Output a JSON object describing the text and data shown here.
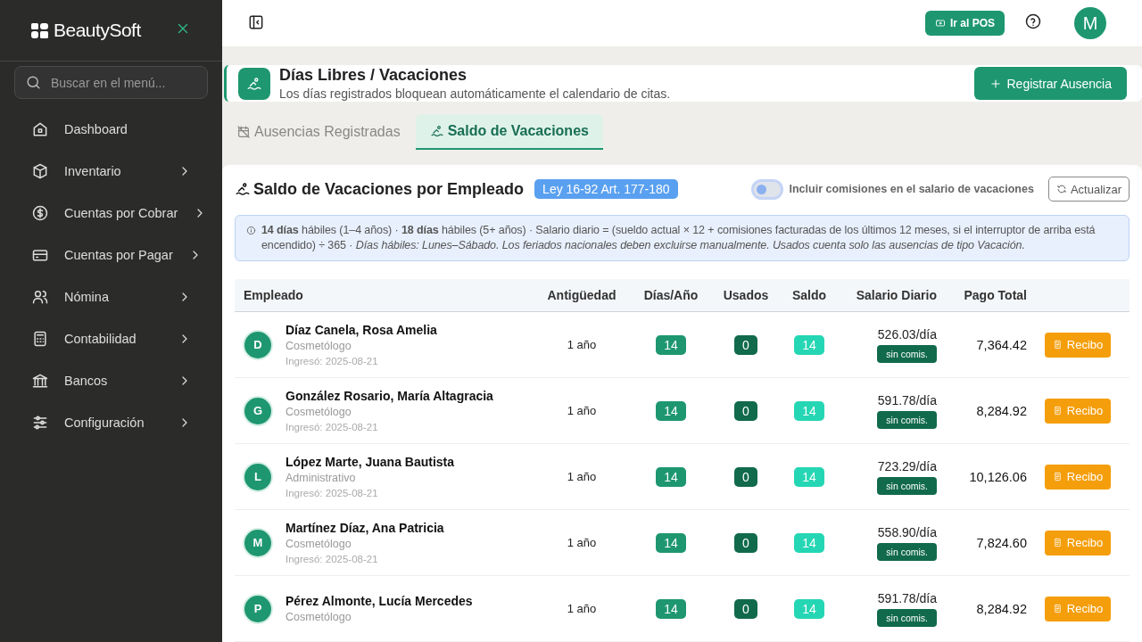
{
  "sidebar": {
    "brand": "BeautySoft",
    "search": {
      "placeholder": "Buscar en el menú..."
    },
    "items": [
      {
        "label": "Dashboard",
        "has_children": false
      },
      {
        "label": "Inventario",
        "has_children": true
      },
      {
        "label": "Cuentas por Cobrar",
        "has_children": true
      },
      {
        "label": "Cuentas por Pagar",
        "has_children": true
      },
      {
        "label": "Nómina",
        "has_children": true
      },
      {
        "label": "Contabilidad",
        "has_children": true
      },
      {
        "label": "Bancos",
        "has_children": true
      },
      {
        "label": "Configuración",
        "has_children": true
      }
    ]
  },
  "topbar": {
    "pos_button": "Ir al POS",
    "avatar": "M"
  },
  "header": {
    "title": "Días Libres / Vacaciones",
    "subtitle": "Los días registrados bloquean automáticamente el calendario de citas.",
    "action": "Registrar Ausencia"
  },
  "tabs": [
    {
      "label": "Ausencias Registradas",
      "selected": false
    },
    {
      "label": "Saldo de Vacaciones",
      "selected": true
    }
  ],
  "panel": {
    "title": "Saldo de Vacaciones por Empleado",
    "law_badge": "Ley 16-92 Art. 177-180",
    "toggle": {
      "label": "Incluir comisiones en el salario de vacaciones",
      "on": false
    },
    "refresh": "Actualizar",
    "info": "**14 días** hábiles (1–4 años) · **18 días** hábiles (5+ años) · Salario diario = (sueldo actual × 12 + comisiones facturadas de los últimos 12 meses, si el interruptor de arriba está encendido) ÷ 365 · *Días hábiles: Lunes–Sábado. Los feriados nacionales deben excluirse manualmente. Usados cuenta solo las ausencias de tipo Vacación.*"
  },
  "table": {
    "columns": [
      "Empleado",
      "Antigüedad",
      "Días/Año",
      "Usados",
      "Saldo",
      "Salario Diario",
      "Pago Total"
    ],
    "rows": [
      {
        "initial": "D",
        "name": "Díaz Canela, Rosa Amelia",
        "role": "Cosmetólogo",
        "hired": "Ingresó: 2025-08-21",
        "seniority": "1 año",
        "days": "14",
        "used": "0",
        "balance": "14",
        "daily": "526.03/día",
        "commission": "sin comis.",
        "total": "7,364.42",
        "action": "Recibo"
      },
      {
        "initial": "G",
        "name": "González Rosario, María Altagracia",
        "role": "Cosmetólogo",
        "hired": "Ingresó: 2025-08-21",
        "seniority": "1 año",
        "days": "14",
        "used": "0",
        "balance": "14",
        "daily": "591.78/día",
        "commission": "sin comis.",
        "total": "8,284.92",
        "action": "Recibo"
      },
      {
        "initial": "L",
        "name": "López Marte, Juana Bautista",
        "role": "Administrativo",
        "hired": "Ingresó: 2025-08-21",
        "seniority": "1 año",
        "days": "14",
        "used": "0",
        "balance": "14",
        "daily": "723.29/día",
        "commission": "sin comis.",
        "total": "10,126.06",
        "action": "Recibo"
      },
      {
        "initial": "M",
        "name": "Martínez Díaz, Ana Patricia",
        "role": "Cosmetólogo",
        "hired": "Ingresó: 2025-08-21",
        "seniority": "1 año",
        "days": "14",
        "used": "0",
        "balance": "14",
        "daily": "558.90/día",
        "commission": "sin comis.",
        "total": "7,824.60",
        "action": "Recibo"
      },
      {
        "initial": "P",
        "name": "Pérez Almonte, Lucía Mercedes",
        "role": "Cosmetólogo",
        "seniority": "1 año",
        "days": "14",
        "used": "0",
        "balance": "14",
        "daily": "591.78/día",
        "commission": "sin comis.",
        "total": "8,284.92",
        "action": "Recibo"
      }
    ]
  }
}
